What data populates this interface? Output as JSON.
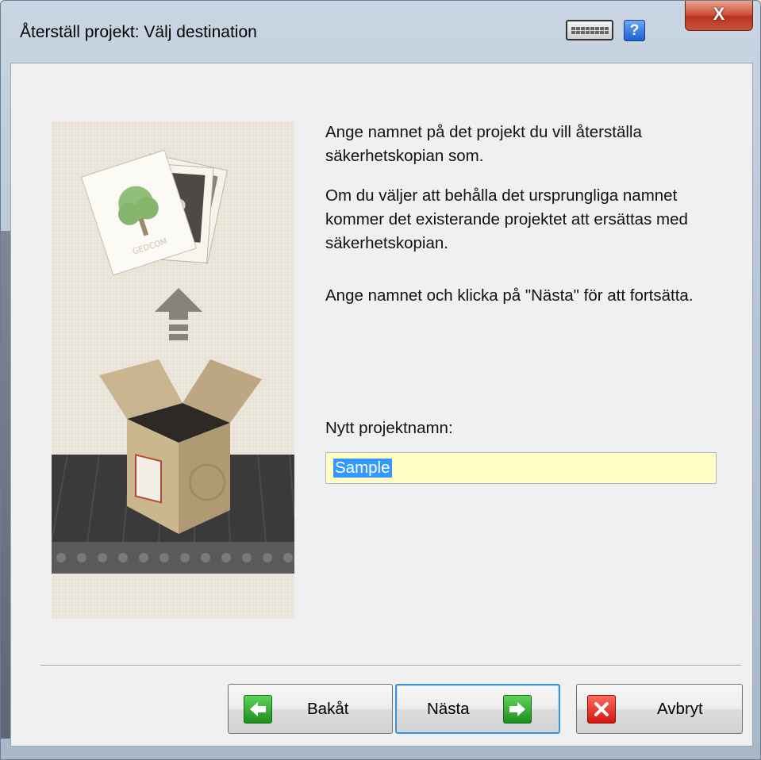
{
  "window": {
    "title": "Återställ projekt: Välj destination",
    "help_label": "?",
    "close_label": "X"
  },
  "instructions": {
    "p1": "Ange namnet på det projekt du vill återställa säkerhetskopian som.",
    "p2": "Om du väljer att behålla det ursprungliga namnet kommer det existerande projektet att ersättas med säkerhetskopian.",
    "p3": "Ange namnet och klicka på \"Nästa\" för att fortsätta."
  },
  "form": {
    "label": "Nytt projektnamn:",
    "value": "Sample"
  },
  "illustration": {
    "card_text": "GEDCOM"
  },
  "buttons": {
    "back": "Bakåt",
    "next": "Nästa",
    "cancel": "Avbryt"
  },
  "colors": {
    "input_background": "#ffffc6",
    "selection": "#3399ff",
    "default_button_border": "#3c8fd8"
  }
}
